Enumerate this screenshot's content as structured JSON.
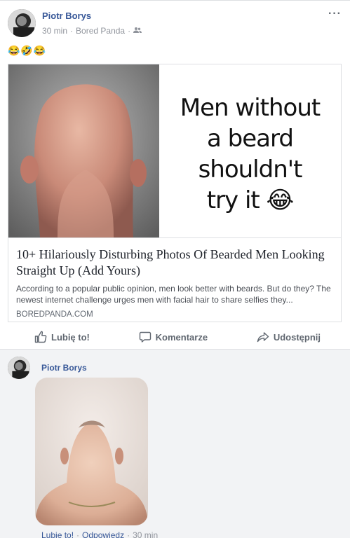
{
  "post": {
    "author": "Piotr Borys",
    "time": "30 min",
    "separator": "·",
    "source": "Bored Panda",
    "audience_icon": "friends-icon",
    "more_label": "···",
    "emojis": "😂🤣😂"
  },
  "link_card": {
    "hero_lines": [
      "Men without",
      "a beard",
      "shouldn't",
      "try it 😂"
    ],
    "title": "10+ Hilariously Disturbing Photos Of Bearded Men Looking Straight Up (Add Yours)",
    "description": "According to a popular public opinion, men look better with beards. But do they? The newest internet challenge urges men with facial hair to share selfies they...",
    "domain": "BOREDPANDA.COM"
  },
  "actions": {
    "like": "Lubię to!",
    "comment": "Komentarze",
    "share": "Udostępnij"
  },
  "comment": {
    "author": "Piotr Borys",
    "like": "Lubię to!",
    "separator": "·",
    "reply": "Odpowiedz",
    "time": "30 min"
  },
  "colors": {
    "link_blue": "#385898",
    "meta_gray": "#90949c",
    "comment_bg": "#f2f3f5"
  }
}
